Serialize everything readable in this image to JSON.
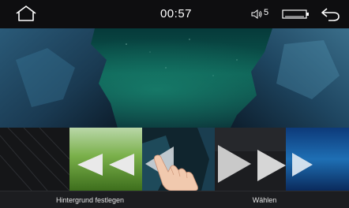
{
  "status_bar": {
    "home_icon": "home-icon",
    "time": "00:57",
    "volume_icon": "speaker-icon",
    "volume_level": "5",
    "screen_icon": "screen-toggle-icon",
    "back_icon": "back-arrow-icon"
  },
  "carousel": {
    "thumbnails": [
      "dark-pattern",
      "green-meadow",
      "dark-rocks",
      "grey-dark",
      "blue-underwater"
    ],
    "overlay_icons": [
      "rewind-arrows-icon",
      "previous-arrow-icon",
      "next-arrows-icon",
      "forward-arrow-icon"
    ],
    "gesture_icon": "swipe-hand-icon"
  },
  "bottom_bar": {
    "set_wallpaper_label": "Hintergrund festlegen",
    "choose_label": "Wählen"
  },
  "colors": {
    "status_bar_bg": "#0e0e10",
    "bottom_bar_bg": "#1c1d20",
    "wallpaper_sky": "#0e5a4e",
    "arrow_fill": "#e9e9e9"
  }
}
